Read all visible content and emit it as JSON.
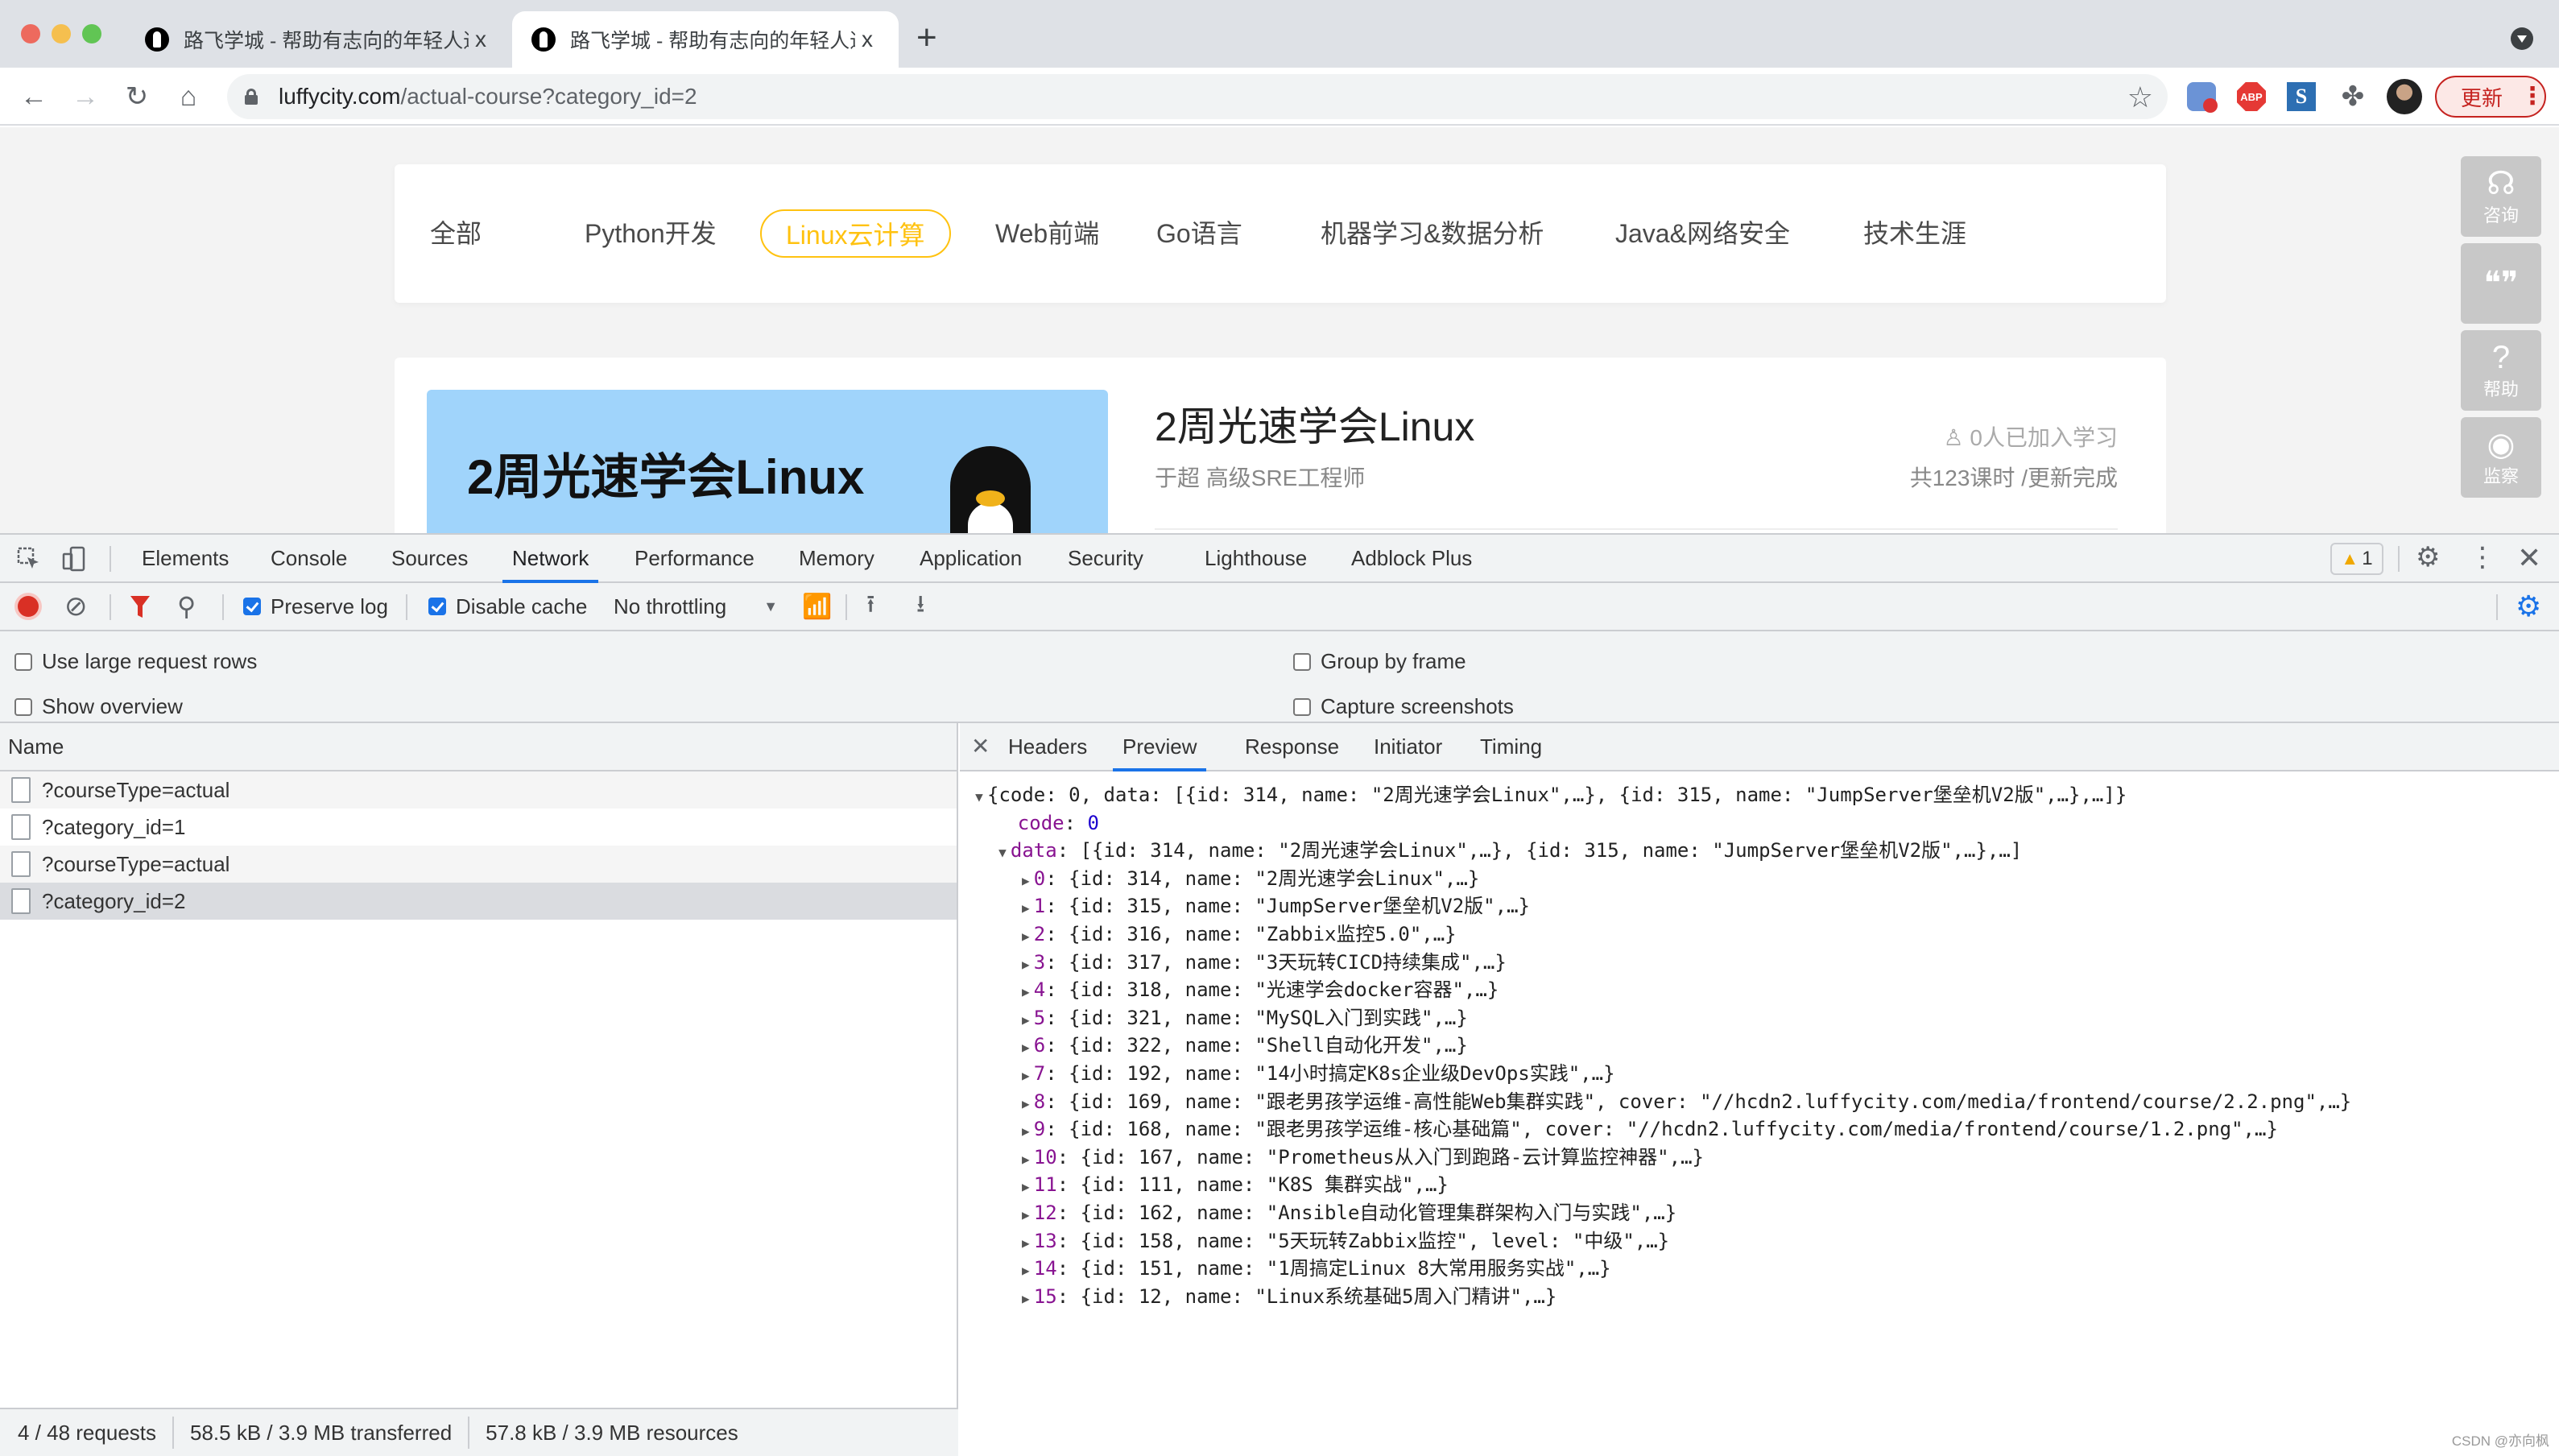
{
  "browser": {
    "tabs": [
      {
        "title": "路飞学城 - 帮助有志向的年轻人通",
        "active": false
      },
      {
        "title": "路飞学城 - 帮助有志向的年轻人通",
        "active": true
      }
    ],
    "close_glyph": "x",
    "newtab_glyph": "+",
    "url_host": "luffycity.com",
    "url_path": "/actual-course?category_id=2",
    "update_label": "更新",
    "extensions": [
      "block-extension",
      "adblock-plus",
      "s-extension",
      "extensions-puzzle"
    ],
    "abp_label": "ABP",
    "s_label": "S"
  },
  "page": {
    "categories": [
      {
        "label": "全部",
        "active": false
      },
      {
        "label": "Python开发",
        "active": false
      },
      {
        "label": "Linux云计算",
        "active": true
      },
      {
        "label": "Web前端",
        "active": false
      },
      {
        "label": "Go语言",
        "active": false
      },
      {
        "label": "机器学习&数据分析",
        "active": false
      },
      {
        "label": "Java&网络安全",
        "active": false
      },
      {
        "label": "技术生涯",
        "active": false
      }
    ],
    "course": {
      "cover_title": "2周光速学会Linux",
      "title": "2周光速学会Linux",
      "teacher": "于超 高级SRE工程师",
      "students": "0人已加入学习",
      "lessons": "共123课时 /更新完成"
    },
    "float_buttons": [
      {
        "icon": "headset-icon",
        "glyph": "🎧",
        "label": "咨询"
      },
      {
        "icon": "wechat-icon",
        "glyph": "💬",
        "label": ""
      },
      {
        "icon": "help-icon",
        "glyph": "?",
        "label": "帮助"
      },
      {
        "icon": "eye-icon",
        "glyph": "◉",
        "label": "监察"
      }
    ]
  },
  "devtools": {
    "tabs": [
      "Elements",
      "Console",
      "Sources",
      "Network",
      "Performance",
      "Memory",
      "Application",
      "Security",
      "Lighthouse",
      "Adblock Plus"
    ],
    "active_tab": "Network",
    "warning_count": "1",
    "toolbar": {
      "preserve_log": {
        "label": "Preserve log",
        "checked": true
      },
      "disable_cache": {
        "label": "Disable cache",
        "checked": true
      },
      "throttling": "No throttling"
    },
    "options": {
      "large_rows": {
        "label": "Use large request rows",
        "checked": false
      },
      "show_overview": {
        "label": "Show overview",
        "checked": false
      },
      "group_by_frame": {
        "label": "Group by frame",
        "checked": false
      },
      "capture_screenshots": {
        "label": "Capture screenshots",
        "checked": false
      }
    },
    "requests": {
      "header": "Name",
      "rows": [
        {
          "name": "?courseType=actual",
          "selected": false
        },
        {
          "name": "?category_id=1",
          "selected": false
        },
        {
          "name": "?courseType=actual",
          "selected": false
        },
        {
          "name": "?category_id=2",
          "selected": true
        }
      ]
    },
    "status": {
      "requests": "4 / 48 requests",
      "transferred": "58.5 kB / 3.9 MB transferred",
      "resources": "57.8 kB / 3.9 MB resources"
    },
    "detail_tabs": [
      "Headers",
      "Preview",
      "Response",
      "Initiator",
      "Timing"
    ],
    "active_detail_tab": "Preview",
    "preview": {
      "root": "{code: 0, data: [{id: 314, name: \"2周光速学会Linux\",…}, {id: 315, name: \"JumpServer堡垒机V2版\",…},…]}",
      "code_key": "code",
      "code_value": "0",
      "data_key": "data",
      "data_summary": "[{id: 314, name: \"2周光速学会Linux\",…}, {id: 315, name: \"JumpServer堡垒机V2版\",…},…]",
      "items": [
        {
          "index": "0",
          "text": "{id: 314, name: \"2周光速学会Linux\",…}"
        },
        {
          "index": "1",
          "text": "{id: 315, name: \"JumpServer堡垒机V2版\",…}"
        },
        {
          "index": "2",
          "text": "{id: 316, name: \"Zabbix监控5.0\",…}"
        },
        {
          "index": "3",
          "text": "{id: 317, name: \"3天玩转CICD持续集成\",…}"
        },
        {
          "index": "4",
          "text": "{id: 318, name: \"光速学会docker容器\",…}"
        },
        {
          "index": "5",
          "text": "{id: 321, name: \"MySQL入门到实践\",…}"
        },
        {
          "index": "6",
          "text": "{id: 322, name: \"Shell自动化开发\",…}"
        },
        {
          "index": "7",
          "text": "{id: 192, name: \"14小时搞定K8s企业级DevOps实践\",…}"
        },
        {
          "index": "8",
          "text": "{id: 169, name: \"跟老男孩学运维-高性能Web集群实践\", cover: \"//hcdn2.luffycity.com/media/frontend/course/2.2.png\",…}"
        },
        {
          "index": "9",
          "text": "{id: 168, name: \"跟老男孩学运维-核心基础篇\", cover: \"//hcdn2.luffycity.com/media/frontend/course/1.2.png\",…}"
        },
        {
          "index": "10",
          "text": "{id: 167, name: \"Prometheus从入门到跑路-云计算监控神器\",…}"
        },
        {
          "index": "11",
          "text": "{id: 111, name: \"K8S 集群实战\",…}"
        },
        {
          "index": "12",
          "text": "{id: 162, name: \"Ansible自动化管理集群架构入门与实践\",…}"
        },
        {
          "index": "13",
          "text": "{id: 158, name: \"5天玩转Zabbix监控\", level: \"中级\",…}"
        },
        {
          "index": "14",
          "text": "{id: 151, name: \"1周搞定Linux 8大常用服务实战\",…}"
        },
        {
          "index": "15",
          "text": "{id: 12, name: \"Linux系统基础5周入门精讲\",…}"
        }
      ]
    }
  },
  "watermark": "CSDN @亦向枫"
}
